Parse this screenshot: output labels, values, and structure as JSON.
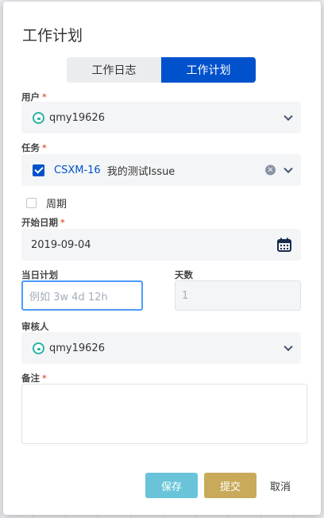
{
  "dialog": {
    "title": "工作计划",
    "tabs": [
      {
        "label": "工作日志",
        "active": false
      },
      {
        "label": "工作计划",
        "active": true
      }
    ]
  },
  "form": {
    "user": {
      "label": "用户",
      "required": "*",
      "value": "qmy19626"
    },
    "task": {
      "label": "任务",
      "required": "*",
      "key": "CSXM-16",
      "name": "我的测试Issue",
      "clear_icon": "×"
    },
    "periodic": {
      "label": "周期",
      "checked": false
    },
    "start_date": {
      "label": "开始日期",
      "required": "*",
      "value": "2019-09-04"
    },
    "daily_plan": {
      "label": "当日计划",
      "placeholder": "例如 3w 4d 12h"
    },
    "days": {
      "label": "天数",
      "value": "1"
    },
    "reviewer": {
      "label": "审核人",
      "value": "qmy19626"
    },
    "note": {
      "label": "备注",
      "required": "*",
      "value": ""
    }
  },
  "buttons": {
    "save": "保存",
    "submit": "提交",
    "cancel": "取消"
  },
  "colors": {
    "primary": "#0052cc",
    "save": "#6ac4d9",
    "submit": "#c8aa5a",
    "focus": "#4c9aff",
    "required": "#de350b"
  }
}
